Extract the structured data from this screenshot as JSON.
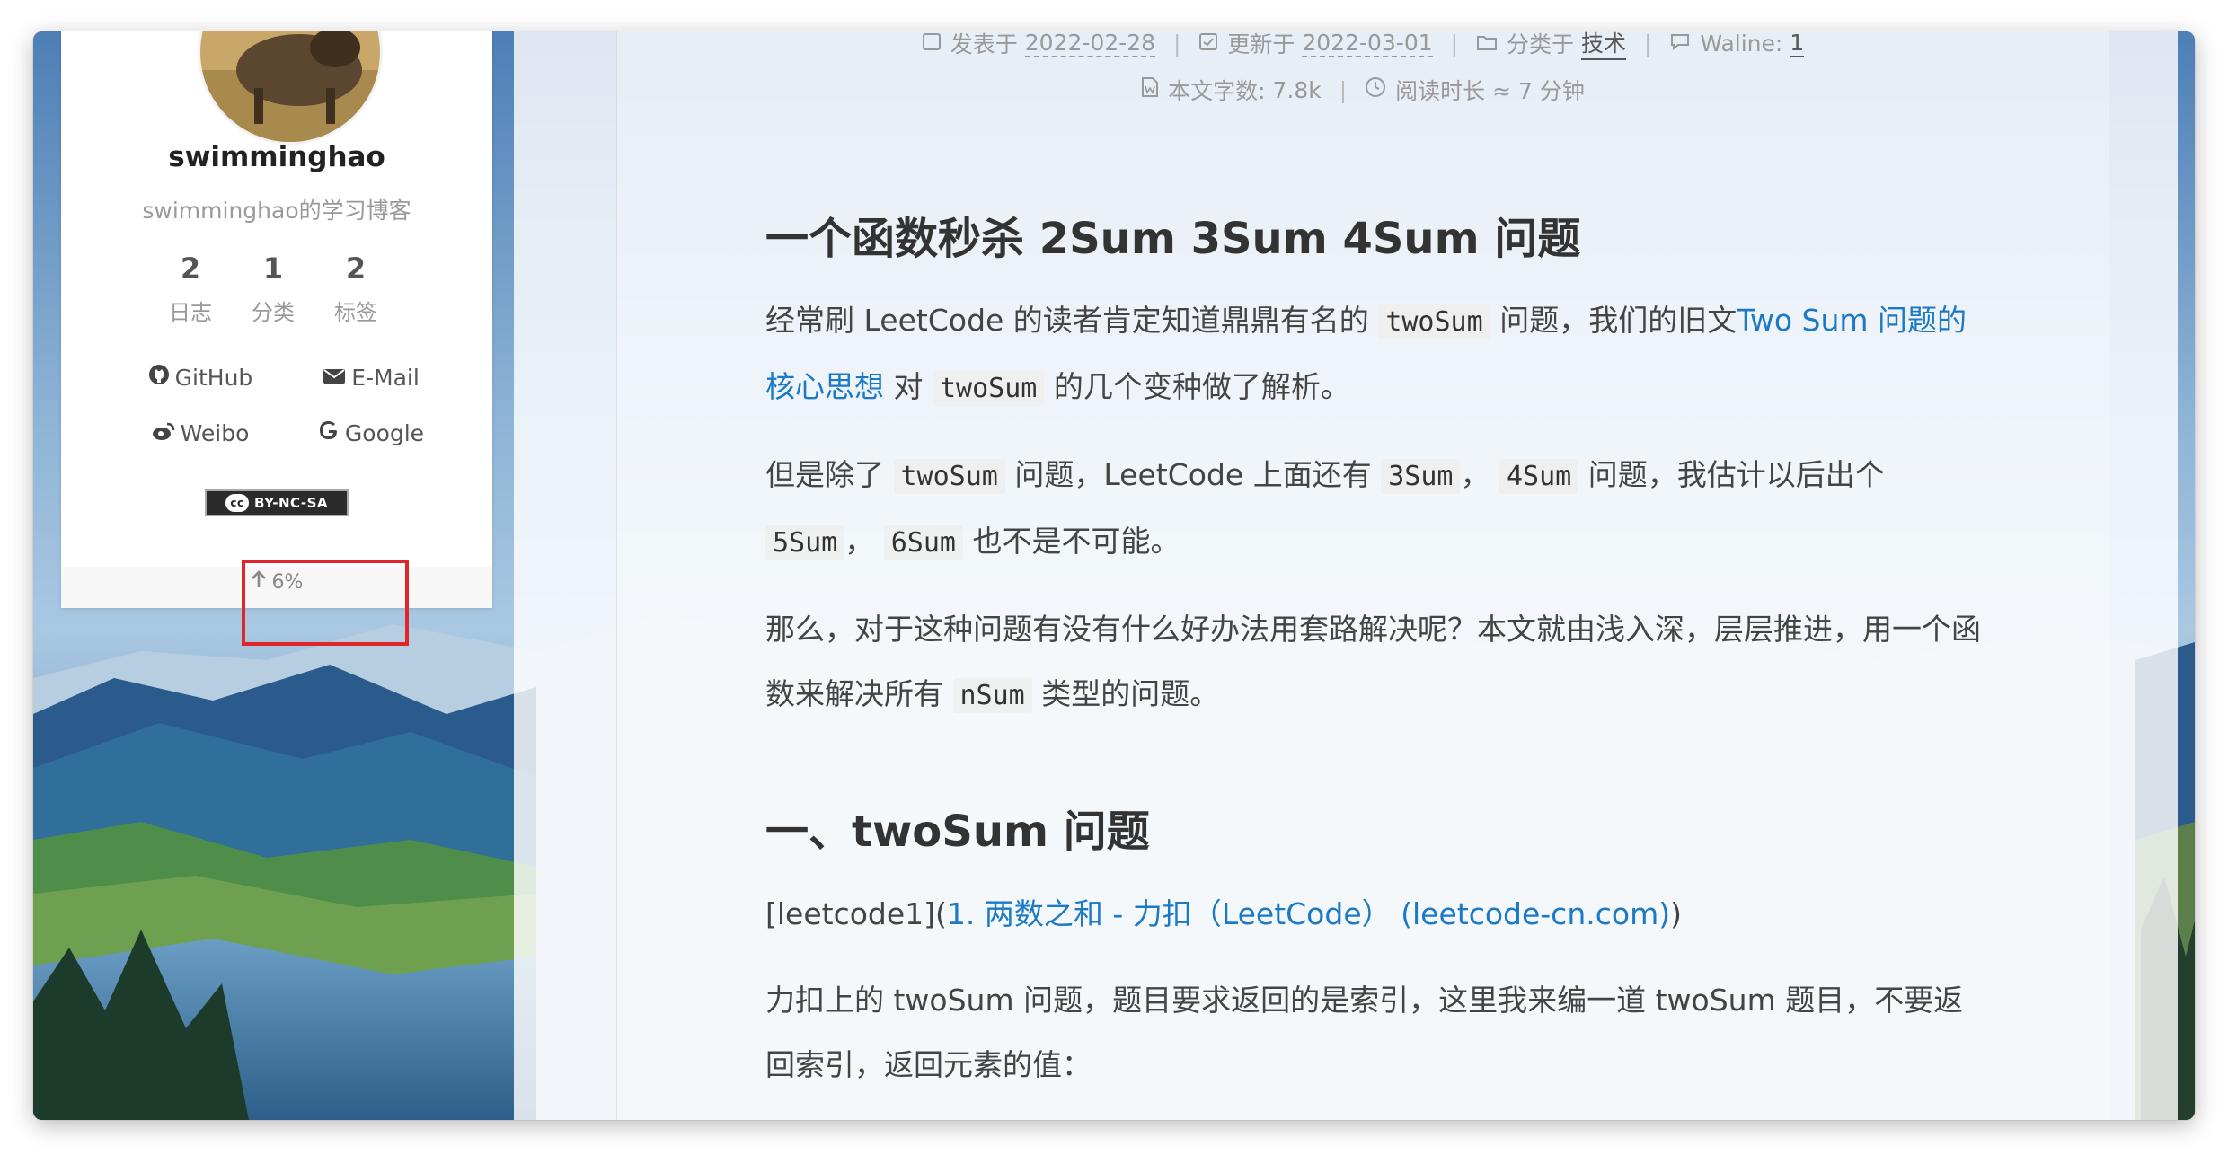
{
  "sidebar": {
    "author_name": "swimminghao",
    "author_description": "swimminghao的学习博客",
    "stats": [
      {
        "count": "2",
        "label": "日志"
      },
      {
        "count": "1",
        "label": "分类"
      },
      {
        "count": "2",
        "label": "标签"
      }
    ],
    "links": [
      {
        "label": "GitHub",
        "icon": "github-icon"
      },
      {
        "label": "E-Mail",
        "icon": "envelope-icon"
      },
      {
        "label": "Weibo",
        "icon": "weibo-icon"
      },
      {
        "label": "Google",
        "icon": "google-icon"
      }
    ],
    "license": "BY-NC-SA",
    "license_cc": "cc",
    "back_to_top": "6%"
  },
  "post_meta": {
    "posted_label": "发表于",
    "posted_date": "2022-02-28",
    "updated_label": "更新于",
    "updated_date": "2022-03-01",
    "category_label": "分类于",
    "category": "技术",
    "comments_label": "Waline:",
    "comments_count": "1",
    "word_count_label": "本文字数:",
    "word_count": "7.8k",
    "reading_time_label": "阅读时长 ≈",
    "reading_time": "7 分钟"
  },
  "article": {
    "heading1": "一个函数秒杀 2Sum 3Sum 4Sum 问题",
    "p1_a": "经常刷 LeetCode 的读者肯定知道鼎鼎有名的",
    "p1_code1": "twoSum",
    "p1_b": "问题，我们的旧文",
    "p1_link": "Two Sum 问题的核心思想",
    "p1_c": "对",
    "p1_code2": "twoSum",
    "p1_d": "的几个变种做了解析。",
    "p2_a": "但是除了",
    "p2_code1": "twoSum",
    "p2_b": "问题，LeetCode 上面还有",
    "p2_code2": "3Sum",
    "p2_c": "，",
    "p2_code3": "4Sum",
    "p2_d": "问题，我估计以后出个",
    "p2_code4": "5Sum",
    "p2_e": "，",
    "p2_code5": "6Sum",
    "p2_f": "也不是不可能。",
    "p3_a": "那么，对于这种问题有没有什么好办法用套路解决呢？本文就由浅入深，层层推进，用一个函数来解决所有",
    "p3_code": "nSum",
    "p3_b": "类型的问题。",
    "heading2": "一、twoSum 问题",
    "p4_a": "[leetcode1](",
    "p4_link": "1. 两数之和 - 力扣（LeetCode） (leetcode-cn.com)",
    "p4_b": ")",
    "p5": "力扣上的 twoSum 问题，题目要求返回的是索引，这里我来编一道 twoSum 题目，不要返回索引，返回元素的值："
  }
}
